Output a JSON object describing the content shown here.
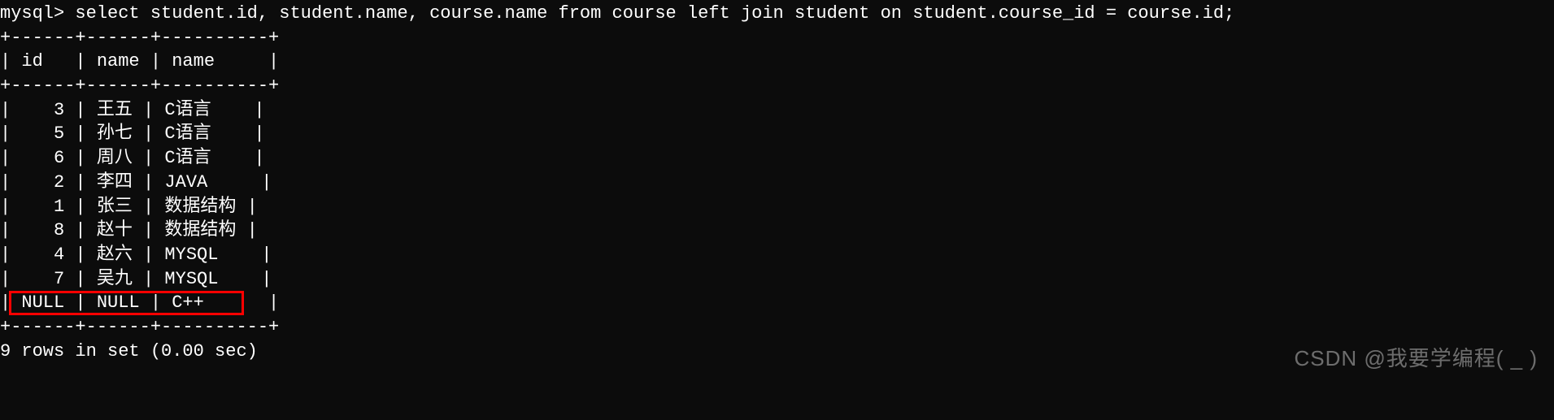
{
  "prompt": "mysql> ",
  "query": "select student.id, student.name, course.name from course left join student on student.course_id = course.id;",
  "table": {
    "border": "+------+------+----------+",
    "header": "| id   | name | name     |",
    "rows": [
      "|    3 | 王五 | C语言    |",
      "|    5 | 孙七 | C语言    |",
      "|    6 | 周八 | C语言    |",
      "|    2 | 李四 | JAVA     |",
      "|    1 | 张三 | 数据结构 |",
      "|    8 | 赵十 | 数据结构 |",
      "|    4 | 赵六 | MYSQL    |",
      "|    7 | 吴九 | MYSQL    |",
      "| NULL | NULL | C++      |"
    ]
  },
  "status": "9 rows in set (0.00 sec)",
  "watermark": "CSDN @我要学编程( _ )",
  "chart_data": {
    "type": "table",
    "columns": [
      "id",
      "name",
      "name"
    ],
    "rows": [
      {
        "id": 3,
        "student_name": "王五",
        "course_name": "C语言"
      },
      {
        "id": 5,
        "student_name": "孙七",
        "course_name": "C语言"
      },
      {
        "id": 6,
        "student_name": "周八",
        "course_name": "C语言"
      },
      {
        "id": 2,
        "student_name": "李四",
        "course_name": "JAVA"
      },
      {
        "id": 1,
        "student_name": "张三",
        "course_name": "数据结构"
      },
      {
        "id": 8,
        "student_name": "赵十",
        "course_name": "数据结构"
      },
      {
        "id": 4,
        "student_name": "赵六",
        "course_name": "MYSQL"
      },
      {
        "id": 7,
        "student_name": "吴九",
        "course_name": "MYSQL"
      },
      {
        "id": null,
        "student_name": null,
        "course_name": "C++"
      }
    ]
  }
}
